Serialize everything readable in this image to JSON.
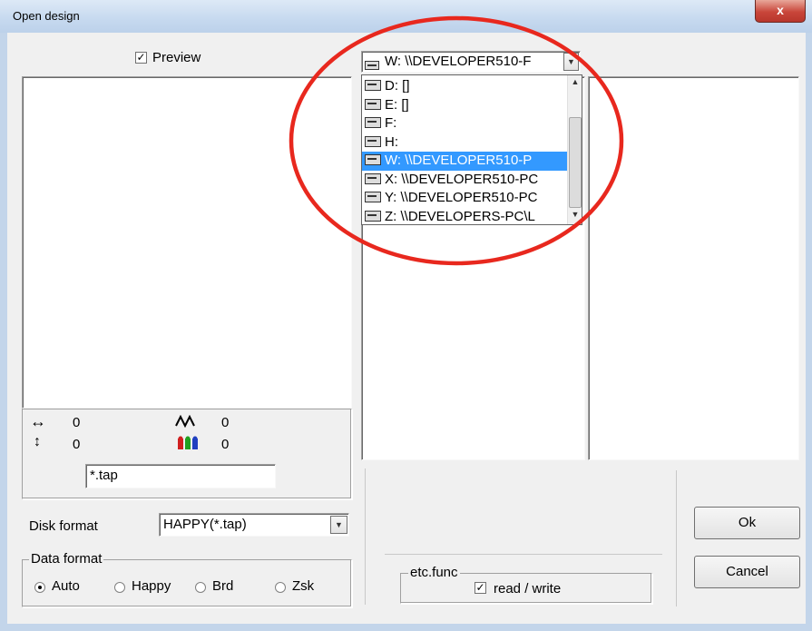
{
  "window": {
    "title": "Open design",
    "close_glyph": "x"
  },
  "preview": {
    "label": "Preview",
    "checked": true
  },
  "stats": {
    "width_icon": "↔",
    "width_value": "0",
    "height_icon": "↕",
    "height_value": "0",
    "stitch_icon": "/\\/\\/",
    "stitch_value": "0",
    "color_value": "0"
  },
  "filter_field": {
    "value": "*.tap"
  },
  "disk_format": {
    "label": "Disk format",
    "selected": "HAPPY(*.tap)"
  },
  "data_format": {
    "legend": "Data format",
    "options": [
      {
        "label": "Auto",
        "selected": true
      },
      {
        "label": "Happy",
        "selected": false
      },
      {
        "label": "Brd",
        "selected": false
      },
      {
        "label": "Zsk",
        "selected": false
      }
    ]
  },
  "drive_select": {
    "selected": "W: \\\\DEVELOPER510-F",
    "options": [
      {
        "label": "D: []",
        "selected": false
      },
      {
        "label": "E: []",
        "selected": false
      },
      {
        "label": "F:",
        "selected": false
      },
      {
        "label": "H:",
        "selected": false
      },
      {
        "label": "W: \\\\DEVELOPER510-P",
        "selected": true
      },
      {
        "label": "X: \\\\DEVELOPER510-PC",
        "selected": false
      },
      {
        "label": "Y: \\\\DEVELOPER510-PC",
        "selected": false
      },
      {
        "label": "Z: \\\\DEVELOPERS-PC\\L",
        "selected": false
      }
    ]
  },
  "etc_func": {
    "legend": "etc.func",
    "read_write_label": "read / write",
    "read_write_checked": true
  },
  "buttons": {
    "ok": "Ok",
    "cancel": "Cancel"
  },
  "annotation": {
    "color": "#e8281e"
  }
}
